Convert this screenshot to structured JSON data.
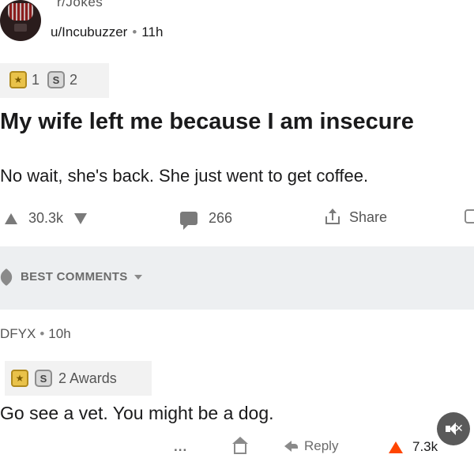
{
  "post": {
    "subreddit": "r/Jokes",
    "author": "u/Incubuzzer",
    "age": "11h",
    "awards": [
      {
        "icon": "gold-award-icon",
        "count": "1"
      },
      {
        "icon": "silver-award-icon",
        "count": "2"
      }
    ],
    "title": "My wife left me because I am insecure",
    "body": "No wait, she's back. She just went to get coffee.",
    "upvotes": "30.3k",
    "comments": "266",
    "share_label": "Share"
  },
  "sort": {
    "label": "BEST COMMENTS"
  },
  "comment": {
    "author": "DFYX",
    "age": "10h",
    "awards_label": "2 Awards",
    "text": "Go see a vet. You might be a dog.",
    "more": "...",
    "reply_label": "Reply",
    "score": "7.3k"
  },
  "colors": {
    "upvote_accent": "#ff4500",
    "band": "#edeff1"
  }
}
